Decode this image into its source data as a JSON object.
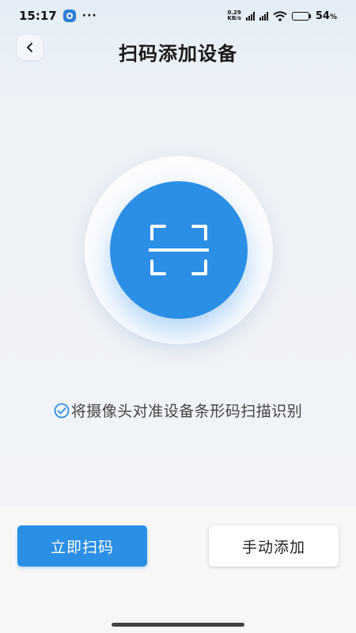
{
  "status_bar": {
    "time": "15:17",
    "more": "···",
    "net_speed_value": "0.29",
    "net_speed_unit": "KB/s",
    "battery_percent": "54",
    "battery_unit": "%",
    "app_icon": "app-notification-icon"
  },
  "header": {
    "back_icon": "chevron-left-icon",
    "title": "扫码添加设备"
  },
  "scanner": {
    "icon": "scan-frame-icon",
    "accent_color": "#2b8fe6"
  },
  "hint": {
    "icon": "check-circle-icon",
    "text": "将摄像头对准设备条形码扫描识别"
  },
  "actions": {
    "scan_now": "立即扫码",
    "manual_add": "手动添加"
  }
}
